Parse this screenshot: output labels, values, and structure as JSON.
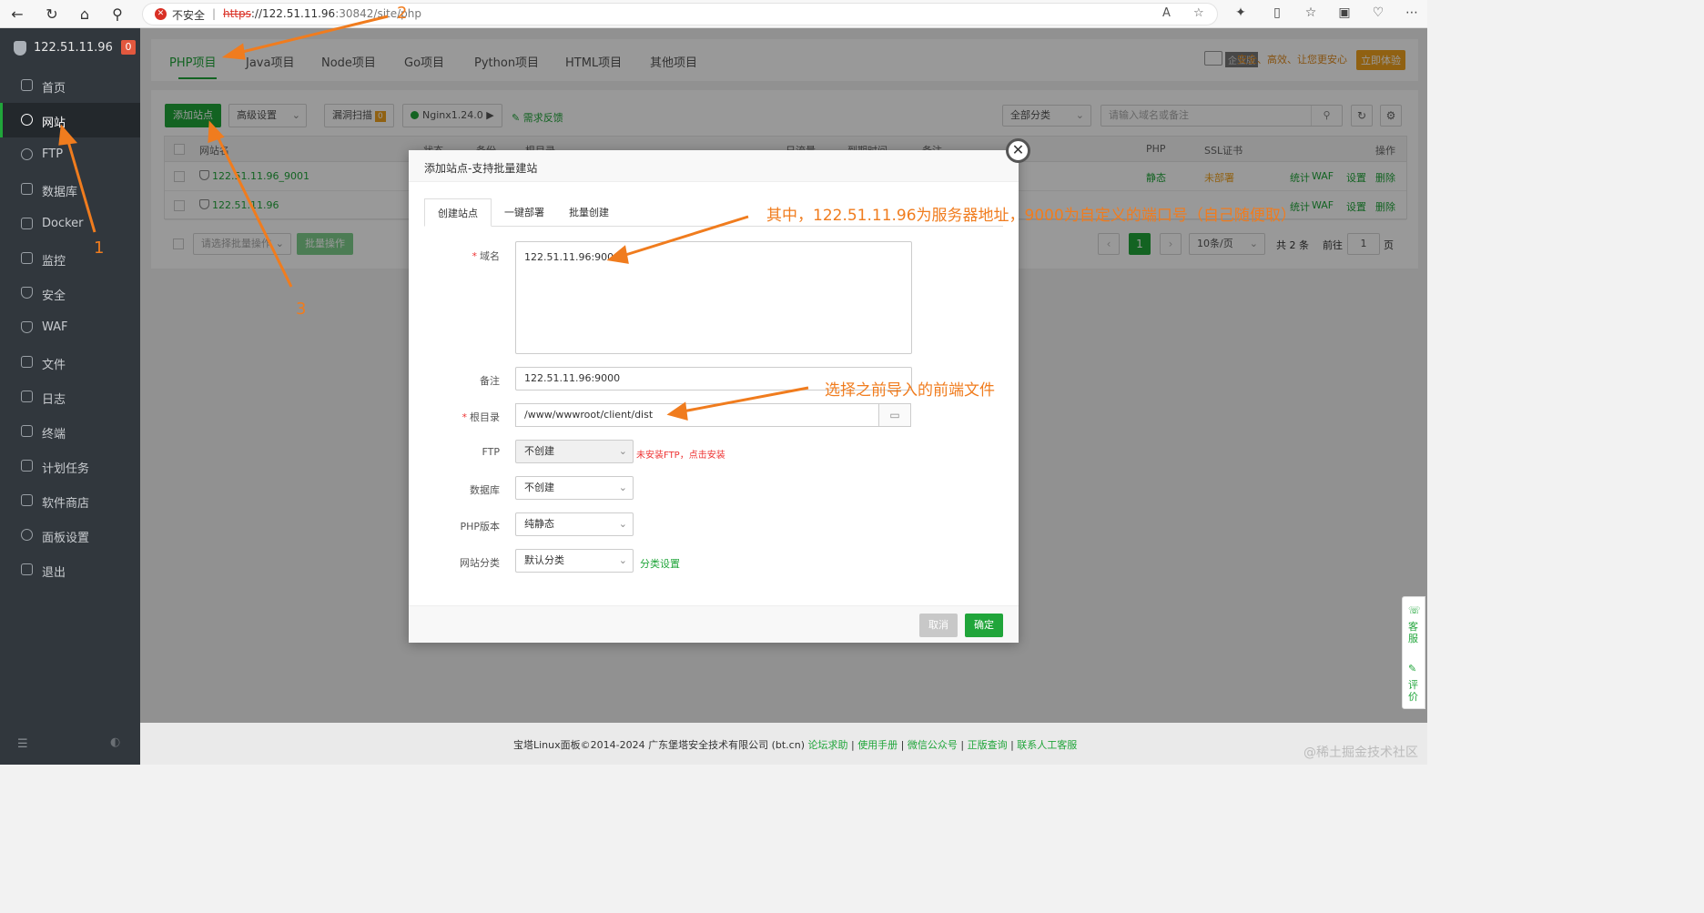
{
  "browser": {
    "insecure_label": "不安全",
    "url_proto": "https",
    "url_host": "://122.51.11.96",
    "url_path": ":30842/site/php"
  },
  "sidebar": {
    "server_ip": "122.51.11.96",
    "badge": "0",
    "items": [
      {
        "label": "首页"
      },
      {
        "label": "网站"
      },
      {
        "label": "FTP"
      },
      {
        "label": "数据库"
      },
      {
        "label": "Docker"
      },
      {
        "label": "监控"
      },
      {
        "label": "安全"
      },
      {
        "label": "WAF"
      },
      {
        "label": "文件"
      },
      {
        "label": "日志"
      },
      {
        "label": "终端"
      },
      {
        "label": "计划任务"
      },
      {
        "label": "软件商店"
      },
      {
        "label": "面板设置"
      },
      {
        "label": "退出"
      }
    ]
  },
  "tabs": [
    {
      "label": "PHP项目"
    },
    {
      "label": "Java项目"
    },
    {
      "label": "Node项目"
    },
    {
      "label": "Go项目"
    },
    {
      "label": "Python项目"
    },
    {
      "label": "HTML项目"
    },
    {
      "label": "其他项目"
    }
  ],
  "promo": {
    "tag": "企业版",
    "text": "安全、高效、让您更安心",
    "button": "立即体验"
  },
  "toolbar": {
    "add_site": "添加站点",
    "advanced": "高级设置",
    "vuln_scan": "漏洞扫描",
    "vuln_count": "0",
    "nginx": "Nginx1.24.0 ▶",
    "feedback": "需求反馈",
    "category": "全部分类",
    "search_placeholder": "请输入域名或备注"
  },
  "table": {
    "headers": [
      "网站名",
      "状态",
      "备份",
      "根目录",
      "日流量",
      "到期时间",
      "备注",
      "PHP",
      "SSL证书",
      "操作"
    ],
    "rows": [
      {
        "site": "122.51.11.96_9001",
        "php": "静态",
        "ssl": "未部署",
        "actions": [
          "统计",
          "WAF",
          "设置",
          "删除"
        ]
      },
      {
        "site": "122.51.11.96",
        "php": "",
        "ssl": "",
        "actions": [
          "统计",
          "WAF",
          "设置",
          "删除"
        ]
      }
    ]
  },
  "batch": {
    "select_placeholder": "请选择批量操作",
    "button": "批量操作"
  },
  "pager": {
    "current": "1",
    "per_page": "10条/页",
    "total": "共 2 条",
    "goto_label": "前往",
    "goto_value": "1",
    "page_unit": "页"
  },
  "dialog": {
    "title": "添加站点-支持批量建站",
    "tabs": [
      "创建站点",
      "一键部署",
      "批量创建"
    ],
    "domain_label": "域名",
    "domain_value": "122.51.11.96:9000",
    "remark_label": "备注",
    "remark_value": "122.51.11.96:9000",
    "root_label": "根目录",
    "root_value": "/www/wwwroot/client/dist",
    "ftp_label": "FTP",
    "ftp_value": "不创建",
    "ftp_hint": "未安装FTP，点击安装",
    "db_label": "数据库",
    "db_value": "不创建",
    "php_label": "PHP版本",
    "php_value": "纯静态",
    "cat_label": "网站分类",
    "cat_value": "默认分类",
    "cat_link": "分类设置",
    "cancel": "取消",
    "confirm": "确定"
  },
  "footer": {
    "copyright": "宝塔Linux面板©2014-2024 广东堡塔安全技术有限公司 (bt.cn)",
    "links": [
      "论坛求助",
      "使用手册",
      "微信公众号",
      "正版查询",
      "联系人工客服"
    ],
    "watermark": "@稀土掘金技术社区"
  },
  "float": {
    "service": "客服",
    "review": "评价"
  },
  "annotations": {
    "n1": "1",
    "n2": "2",
    "n3": "3",
    "note_domain": "其中，122.51.11.96为服务器地址，9000为自定义的端口号（自己随便取）",
    "note_root": "选择之前导入的前端文件"
  },
  "colors": {
    "accent": "#20a53a",
    "annotation": "#f07c1e",
    "sidebar_bg": "#31373d"
  }
}
